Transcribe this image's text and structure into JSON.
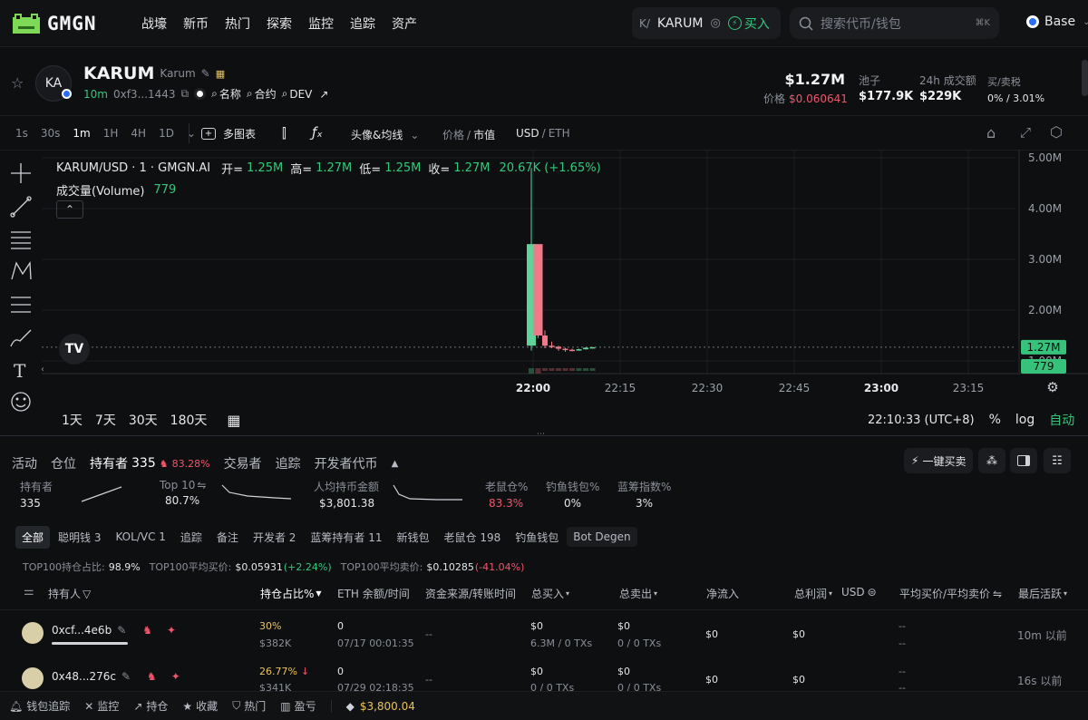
{
  "nav": {
    "logo": "GMGN",
    "items": [
      "战壕",
      "新币",
      "热门",
      "探索",
      "监控",
      "追踪",
      "资产"
    ],
    "token_pill": {
      "icon": "K/",
      "name": "KARUM",
      "buy": "买入"
    },
    "search_placeholder": "搜索代币/钱包",
    "search_kbd": "⌘K",
    "chain": "Base"
  },
  "token": {
    "avatar": "KA",
    "symbol": "KARUM",
    "name": "Karum",
    "age": "10m",
    "address": "0xf3...1443",
    "links": [
      "名称",
      "合约",
      "DEV"
    ],
    "market_cap": "$1.27M",
    "price_label": "价格",
    "price": "$0.060641",
    "pool_label": "池子",
    "pool": "$177.9K",
    "volume_label": "24h 成交额",
    "volume": "$229K",
    "tax_label": "买/卖税",
    "tax": "0% / 3.01%"
  },
  "chart_toolbar": {
    "intervals": [
      "1s",
      "30s",
      "1m",
      "1H",
      "4H",
      "1D"
    ],
    "active_interval": "1m",
    "multi_chart": "多图表",
    "avatar_ma": "头像&均线",
    "price_label": "价格",
    "mcap_label": "市值",
    "usd_label": "USD",
    "eth_label": "ETH"
  },
  "chart_legend": {
    "pair": "KARUM/USD · 1 · GMGN.AI",
    "open_label": "开=",
    "open": "1.25M",
    "high_label": "高=",
    "high": "1.27M",
    "low_label": "低=",
    "low": "1.25M",
    "close_label": "收=",
    "close": "1.27M",
    "change": "20.67K (+1.65%)",
    "volume_label": "成交量(Volume)",
    "volume": "779"
  },
  "chart_data": {
    "type": "candlestick",
    "y_axis_ticks": [
      "5.00M",
      "4.00M",
      "3.00M",
      "2.00M",
      "1.00M"
    ],
    "ylim": [
      1000000,
      5000000
    ],
    "x_axis_ticks": [
      "22:00",
      "22:15",
      "22:30",
      "22:45",
      "23:00",
      "23:15"
    ],
    "current_price_tag": "1.27M",
    "current_volume_tag": "779",
    "candles": [
      {
        "o": 1300000,
        "c": 3300000,
        "h": 4800000,
        "l": 1200000
      },
      {
        "o": 3300000,
        "c": 1500000,
        "h": 3300000,
        "l": 1450000
      },
      {
        "o": 1500000,
        "c": 1300000,
        "h": 1600000,
        "l": 1250000
      },
      {
        "o": 1300000,
        "c": 1280000,
        "h": 1380000,
        "l": 1250000
      },
      {
        "o": 1280000,
        "c": 1240000,
        "h": 1300000,
        "l": 1200000
      },
      {
        "o": 1240000,
        "c": 1220000,
        "h": 1260000,
        "l": 1180000
      },
      {
        "o": 1220000,
        "c": 1210000,
        "h": 1240000,
        "l": 1190000
      },
      {
        "o": 1210000,
        "c": 1230000,
        "h": 1240000,
        "l": 1200000
      },
      {
        "o": 1230000,
        "c": 1260000,
        "h": 1270000,
        "l": 1220000
      },
      {
        "o": 1250000,
        "c": 1270000,
        "h": 1275000,
        "l": 1245000
      }
    ]
  },
  "chart_footer": {
    "ranges": [
      "1天",
      "7天",
      "30天",
      "180天"
    ],
    "time": "22:10:33 (UTC+8)",
    "pct": "%",
    "log": "log",
    "auto": "自动"
  },
  "tabs": {
    "items": [
      "活动",
      "仓位",
      "持有者",
      "交易者",
      "追踪",
      "开发者代币"
    ],
    "active": "持有者",
    "holders_count": "335",
    "holders_pct": "83.28%",
    "one_click": "一键买卖"
  },
  "holder_stats": [
    {
      "label": "持有者",
      "value": "335",
      "color": "#e6e7ea"
    },
    {
      "label": "Top 10",
      "value": "80.7%",
      "color": "#e6e7ea"
    },
    {
      "label": "人均持币金额",
      "value": "$3,801.38",
      "color": "#e6e7ea"
    },
    {
      "label": "老鼠仓%",
      "value": "83.3%",
      "color": "#f0566b"
    },
    {
      "label": "钓鱼钱包%",
      "value": "0%",
      "color": "#e6e7ea"
    },
    {
      "label": "蓝筹指数%",
      "value": "3%",
      "color": "#e6e7ea"
    }
  ],
  "filters": [
    "全部",
    "聪明钱 3",
    "KOL/VC 1",
    "追踪",
    "备注",
    "开发者 2",
    "蓝筹持有者 11",
    "新钱包",
    "老鼠仓 198",
    "钓鱼钱包",
    "Bot Degen"
  ],
  "summary": {
    "t1_label": "TOP100持仓占比:",
    "t1": "98.9%",
    "t2_label": "TOP100平均买价:",
    "t2": "$0.05931",
    "t2c": "(+2.24%)",
    "t3_label": "TOP100平均卖价:",
    "t3": "$0.10285",
    "t3c": "(-41.04%)"
  },
  "table": {
    "headers": [
      "持有人",
      "持仓占比%",
      "ETH 余额/时间",
      "资金来源/转账时间",
      "总买入",
      "总卖出",
      "净流入",
      "总利润",
      "USD",
      "平均买价/平均卖价",
      "最后活跃"
    ],
    "rows": [
      {
        "addr": "0xcf...4e6b",
        "pct": "30%",
        "pct_usd": "$382K",
        "eth": "0",
        "eth_time": "07/17 00:01:35",
        "source": "--",
        "buy": "$0",
        "buy_sub": "6.3M / 0 TXs",
        "sell": "$0",
        "sell_sub": "0 / 0 TXs",
        "net": "$0",
        "profit": "$0",
        "avg1": "--",
        "avg2": "--",
        "last": "10m 以前"
      },
      {
        "addr": "0x48...276c",
        "pct": "26.77%",
        "pct_usd": "$341K",
        "eth": "0",
        "eth_time": "07/29 02:18:35",
        "source": "--",
        "buy": "$0",
        "buy_sub": "0 / 0 TXs",
        "sell": "$0",
        "sell_sub": "0 / 0 TXs",
        "net": "$0",
        "profit": "$0",
        "avg1": "--",
        "avg2": "--",
        "last": "16s 以前"
      }
    ]
  },
  "bottombar": {
    "items": [
      "钱包追踪",
      "监控",
      "持仓",
      "收藏",
      "热门",
      "盈亏"
    ],
    "eth_price": "$3,800.04"
  }
}
